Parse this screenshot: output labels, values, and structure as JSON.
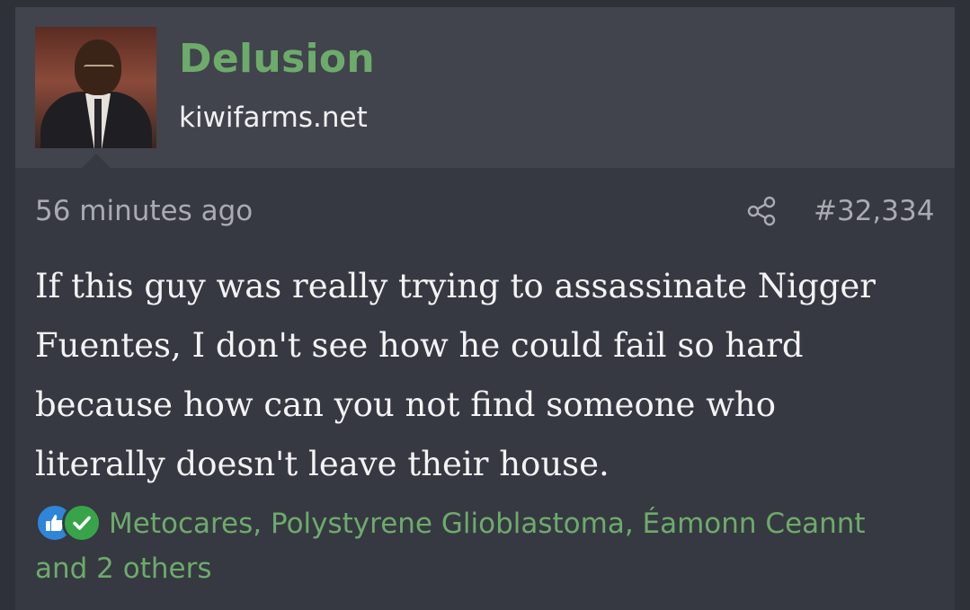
{
  "header": {
    "username": "Delusion",
    "site": "kiwifarms.net",
    "avatar_icon": "user-avatar-photo"
  },
  "meta": {
    "time": "56 minutes ago",
    "share_icon": "share-icon",
    "post_number": "#32,334"
  },
  "post": {
    "lines": [
      "If this guy was really trying to assassinate Nigger",
      "Fuentes, I don't see how he could fail so hard",
      "because how can you not find someone who",
      "literally doesn't leave their house."
    ]
  },
  "reactions": {
    "icons": [
      "like-icon",
      "agree-check-icon"
    ],
    "names": "Metocares, Polystyrene Glioblastoma, Éamonn Ceannt",
    "others": "and 2 others"
  },
  "colors": {
    "username": "#6dab6b",
    "reaction_text": "#6dab6b",
    "like": "#2f86d8",
    "agree": "#38a44a",
    "header_bg": "#41444c",
    "body_bg": "#363941"
  }
}
